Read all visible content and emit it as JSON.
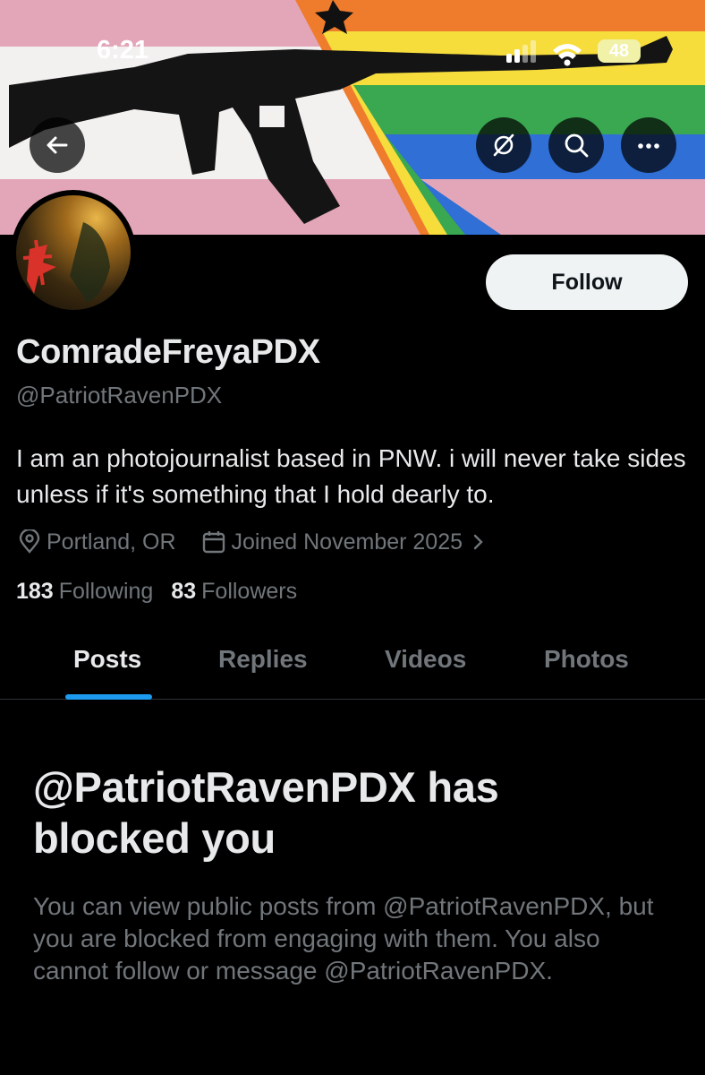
{
  "status_bar": {
    "time": "6:21",
    "battery": "48"
  },
  "nav": {
    "back_icon": "arrow-left-icon",
    "sync_icon": "broken-sync-icon",
    "search_icon": "search-icon",
    "more_icon": "more-horizontal-icon"
  },
  "profile": {
    "follow_label": "Follow",
    "display_name": "ComradeFreyaPDX",
    "handle": "@PatriotRavenPDX",
    "bio": "I am an photojournalist based in PNW. i will never take sides unless if it's something that I hold dearly to.",
    "location": "Portland, OR",
    "joined": "Joined November 2025",
    "following_count": "183",
    "following_label": "Following",
    "followers_count": "83",
    "followers_label": "Followers"
  },
  "tabs": [
    {
      "label": "Posts",
      "active": true
    },
    {
      "label": "Replies",
      "active": false
    },
    {
      "label": "Videos",
      "active": false
    },
    {
      "label": "Photos",
      "active": false
    }
  ],
  "blocked": {
    "title": "@PatriotRavenPDX has blocked you",
    "body": "You can view public posts from @PatriotRavenPDX, but you are blocked from engaging with them. You also cannot follow or message @PatriotRavenPDX."
  },
  "colors": {
    "background": "#000000",
    "accent": "#1d9bf0",
    "text_primary": "#e7e9ea",
    "text_secondary": "#71767b",
    "follow_button_bg": "#eff3f4"
  }
}
